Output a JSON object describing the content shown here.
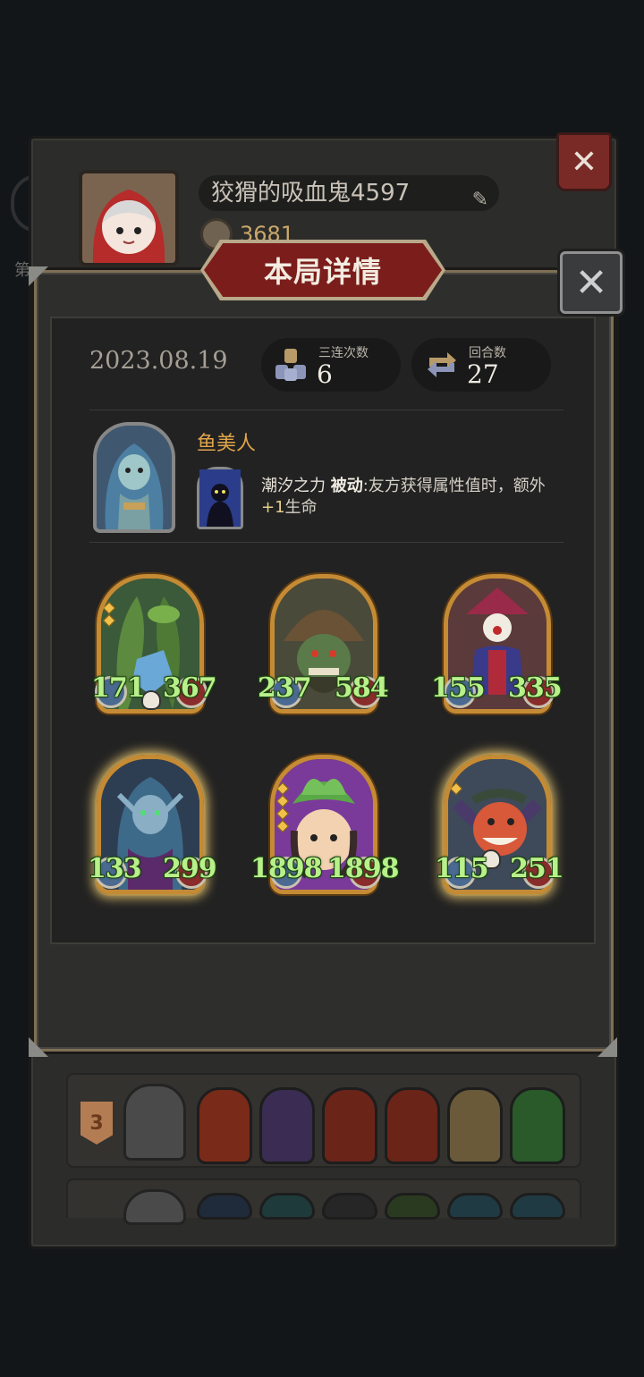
{
  "background": {
    "player_name": "狡猾的吸血鬼4597",
    "coins": "3681",
    "side_text": "第",
    "row_rank": "3"
  },
  "modal": {
    "title": "本局详情",
    "date": "2023.08.19",
    "stats": [
      {
        "label": "三连次数",
        "value": "6",
        "icon": "triple-merge-icon"
      },
      {
        "label": "回合数",
        "value": "27",
        "icon": "rounds-cycle-icon"
      }
    ],
    "hero": {
      "name": "鱼美人",
      "skill_name": "潮汐之力",
      "skill_type": "被动",
      "skill_desc_prefix": ":友方获得属性值时，额外",
      "skill_desc_plus": "+1",
      "skill_desc_suffix": "生命"
    },
    "units": [
      {
        "attack": "171",
        "health": "367",
        "frame": "gold",
        "gems": 2,
        "skull": true,
        "glow": false
      },
      {
        "attack": "237",
        "health": "584",
        "frame": "gold",
        "gems": 0,
        "skull": false,
        "glow": false
      },
      {
        "attack": "155",
        "health": "335",
        "frame": "gold",
        "gems": 0,
        "skull": false,
        "glow": false
      },
      {
        "attack": "133",
        "health": "299",
        "frame": "gold",
        "gems": 0,
        "skull": false,
        "glow": true
      },
      {
        "attack": "1898",
        "health": "1898",
        "frame": "gold-purple",
        "gems": 4,
        "skull": false,
        "glow": false
      },
      {
        "attack": "115",
        "health": "251",
        "frame": "gold",
        "gems": 1,
        "skull": true,
        "glow": true
      }
    ]
  },
  "colors": {
    "stat_green": "#b8f08a",
    "hero_name": "#e0a54a",
    "banner_red": "#7a1d1b",
    "frame_gold": "#c58b34"
  }
}
